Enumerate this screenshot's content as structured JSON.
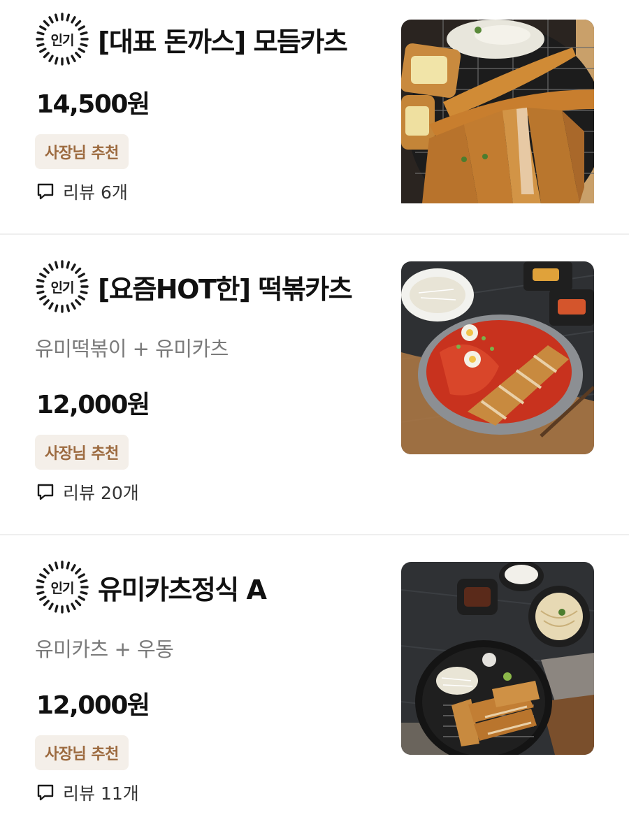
{
  "menu": [
    {
      "popular_label": "인기",
      "title": "[대표 돈까스] 모듬카츠",
      "description": "",
      "price": "14,500원",
      "badge": "사장님 추천",
      "review_text": "리뷰 6개"
    },
    {
      "popular_label": "인기",
      "title": "[요즘HOT한] 떡볶카츠",
      "description": "유미떡볶이 + 유미카츠",
      "price": "12,000원",
      "badge": "사장님 추천",
      "review_text": "리뷰 20개"
    },
    {
      "popular_label": "인기",
      "title": "유미카츠정식 A",
      "description": "유미카츠 + 우동",
      "price": "12,000원",
      "badge": "사장님 추천",
      "review_text": "리뷰 11개"
    }
  ],
  "icons": {
    "popular": "sunburst-icon",
    "review": "speech-bubble-icon"
  },
  "colors": {
    "badge_bg": "#f4efe9",
    "badge_text": "#9c6a3f",
    "divider": "#efefef"
  }
}
